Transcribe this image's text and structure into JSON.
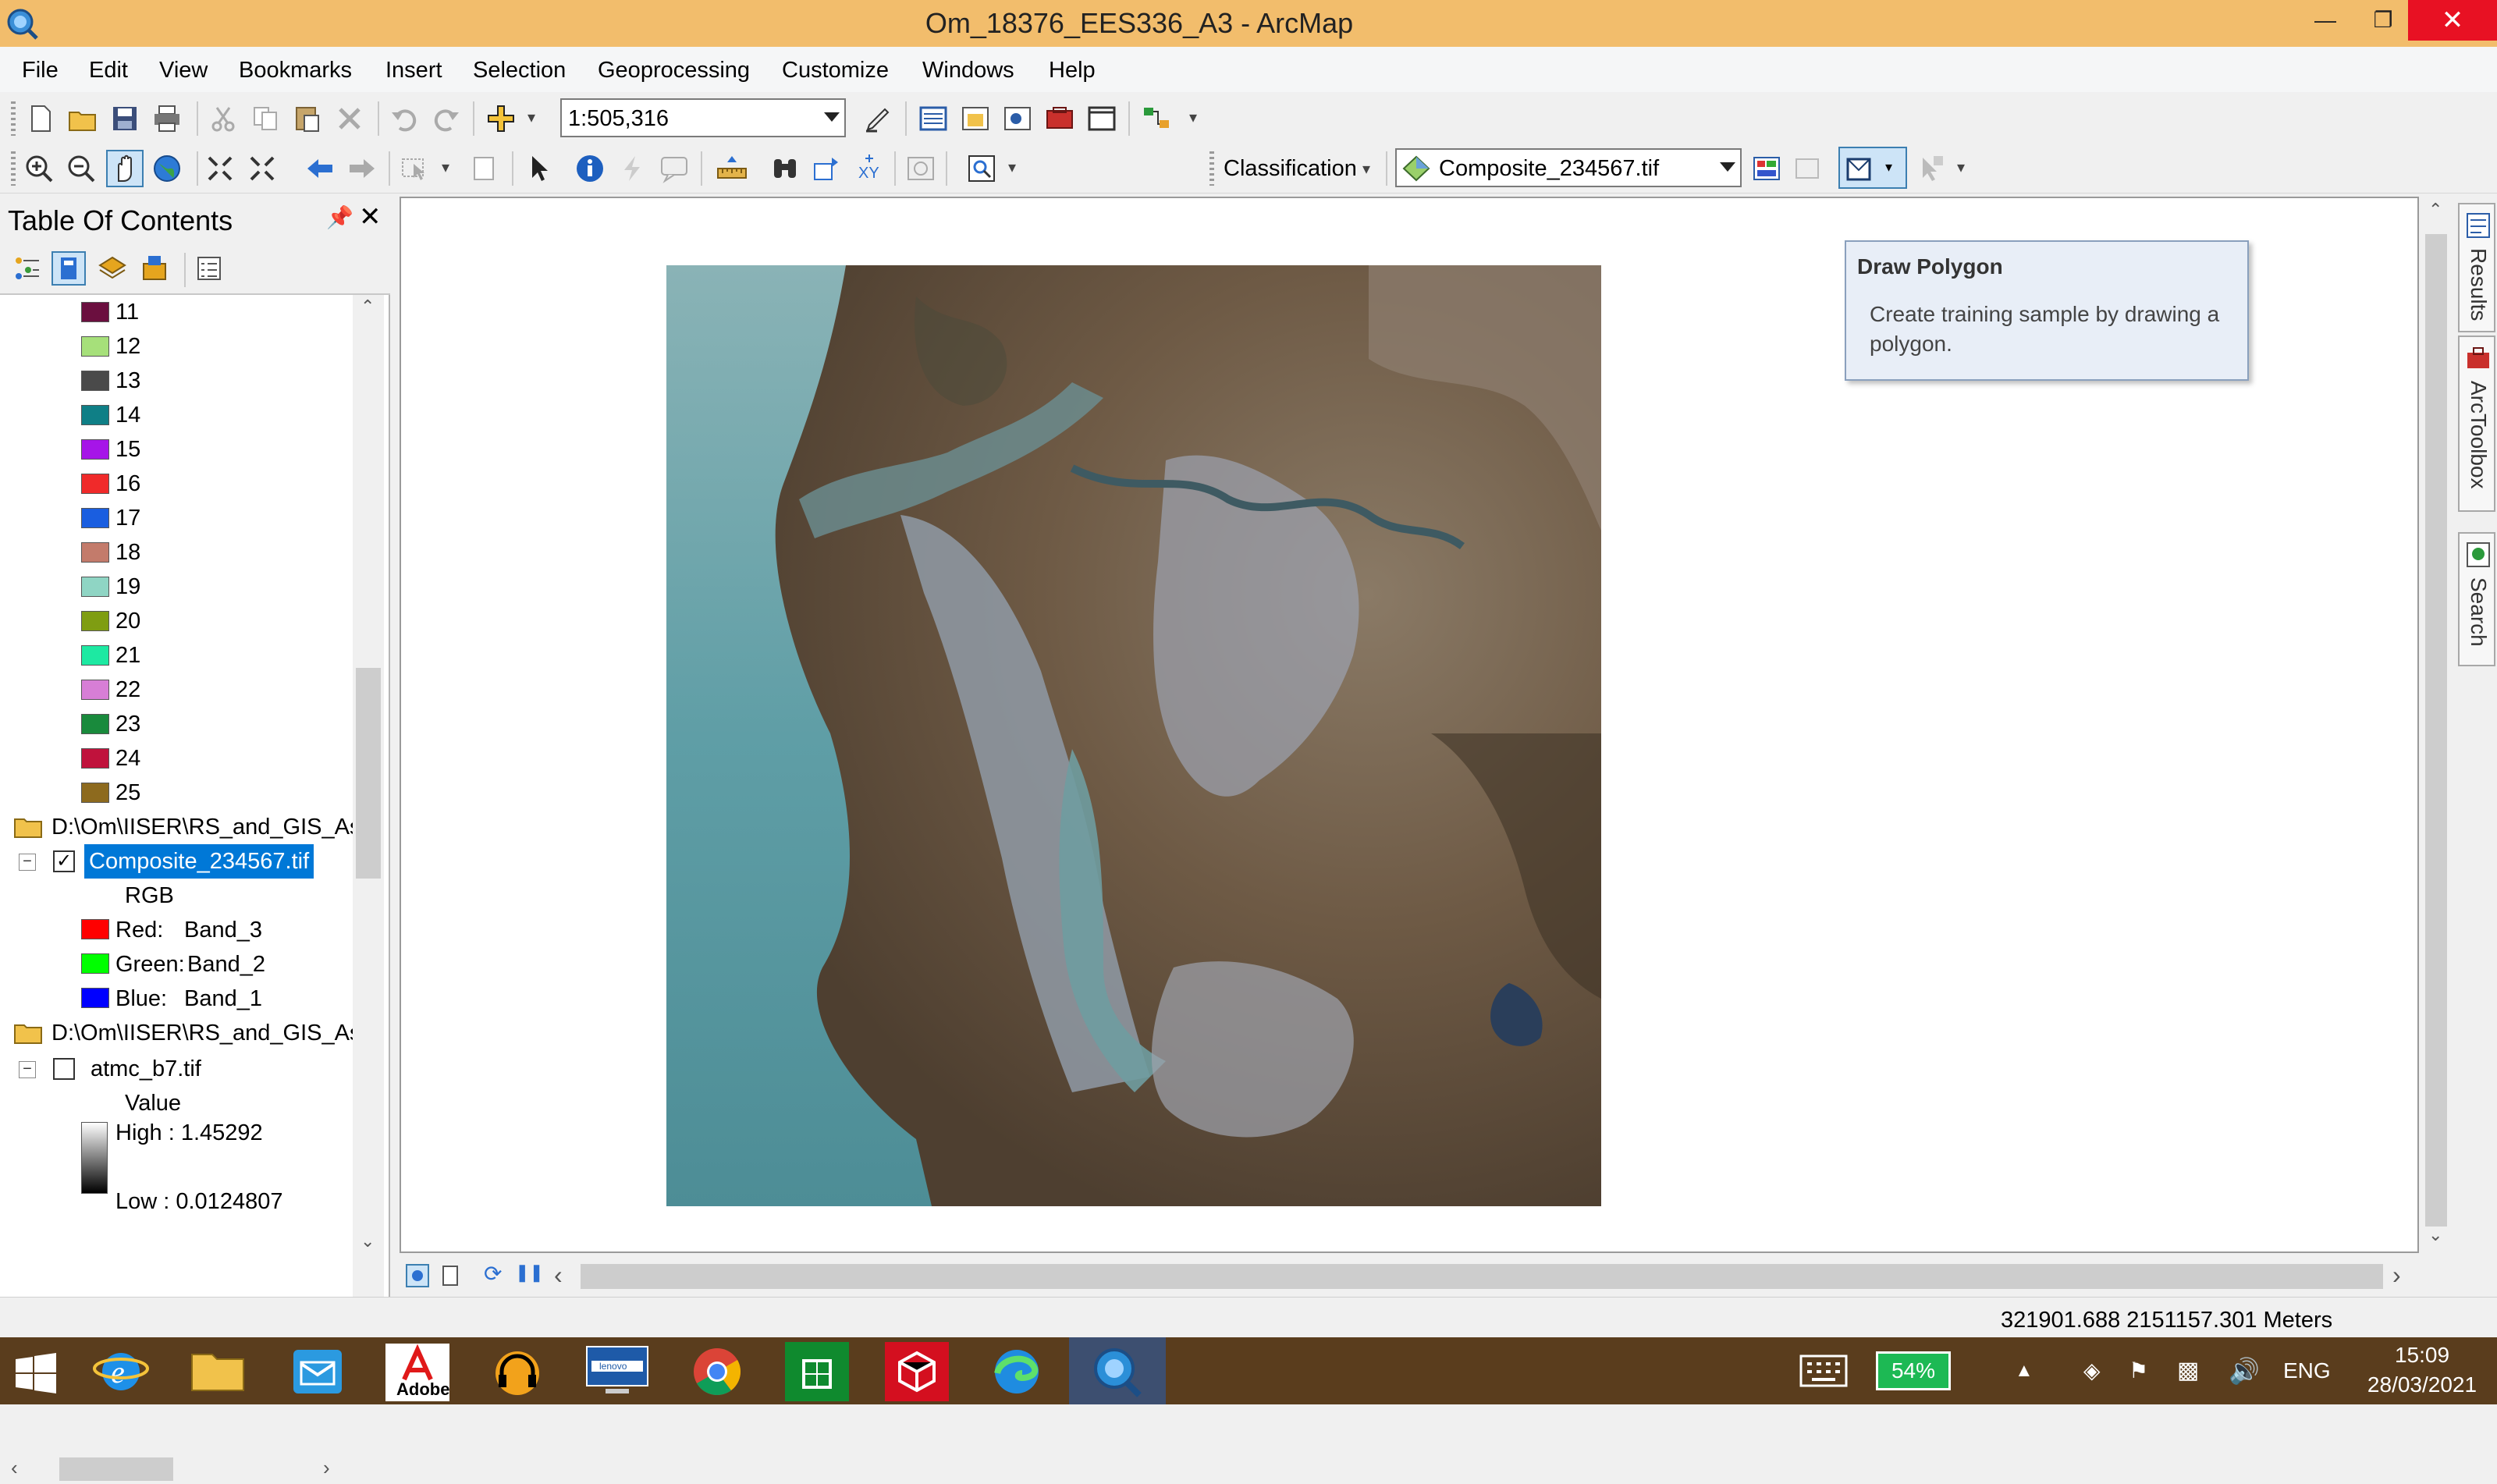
{
  "window": {
    "title": "Om_18376_EES336_A3 - ArcMap"
  },
  "menu": [
    "File",
    "Edit",
    "View",
    "Bookmarks",
    "Insert",
    "Selection",
    "Geoprocessing",
    "Customize",
    "Windows",
    "Help"
  ],
  "toolbar": {
    "scale_value": "1:505,316",
    "classification_label": "Classification",
    "classification_layer": "Composite_234567.tif"
  },
  "toc": {
    "title": "Table Of Contents",
    "classes": [
      {
        "label": "11",
        "color": "#6b0f3f"
      },
      {
        "label": "12",
        "color": "#a6e07a"
      },
      {
        "label": "13",
        "color": "#4a4a4a"
      },
      {
        "label": "14",
        "color": "#0f7f86"
      },
      {
        "label": "15",
        "color": "#a615e8"
      },
      {
        "label": "16",
        "color": "#f02a2a"
      },
      {
        "label": "17",
        "color": "#1a5ee0"
      },
      {
        "label": "18",
        "color": "#c37b6b"
      },
      {
        "label": "19",
        "color": "#8fd5c4"
      },
      {
        "label": "20",
        "color": "#7f9d12"
      },
      {
        "label": "21",
        "color": "#1de9a2"
      },
      {
        "label": "22",
        "color": "#d77ed6"
      },
      {
        "label": "23",
        "color": "#198a3c"
      },
      {
        "label": "24",
        "color": "#c0123c"
      },
      {
        "label": "25",
        "color": "#8d6a1e"
      }
    ],
    "folder1": "D:\\Om\\IISER\\RS_and_GIS_Ass",
    "layer1": {
      "name": "Composite_234567.tif",
      "checked": true,
      "renderer": "RGB",
      "bands": [
        {
          "label": "Red:",
          "band": "Band_3",
          "color": "#ff0000"
        },
        {
          "label": "Green:",
          "band": "Band_2",
          "color": "#00ff00"
        },
        {
          "label": "Blue:",
          "band": "Band_1",
          "color": "#0000ff"
        }
      ]
    },
    "folder2": "D:\\Om\\IISER\\RS_and_GIS_Ass",
    "layer2": {
      "name": "atmc_b7.tif",
      "checked": false,
      "value_label": "Value",
      "high": "High : 1.45292",
      "low": "Low : 0.0124807"
    }
  },
  "tooltip": {
    "title": "Draw Polygon",
    "body": "Create training sample by drawing a polygon."
  },
  "dock_tabs": [
    "Results",
    "ArcToolbox",
    "Search"
  ],
  "status": {
    "coordinates": "321901.688  2151157.301 Meters"
  },
  "taskbar": {
    "battery": "54%",
    "language": "ENG",
    "time": "15:09",
    "date": "28/03/2021",
    "adobe_label": "Adobe"
  }
}
